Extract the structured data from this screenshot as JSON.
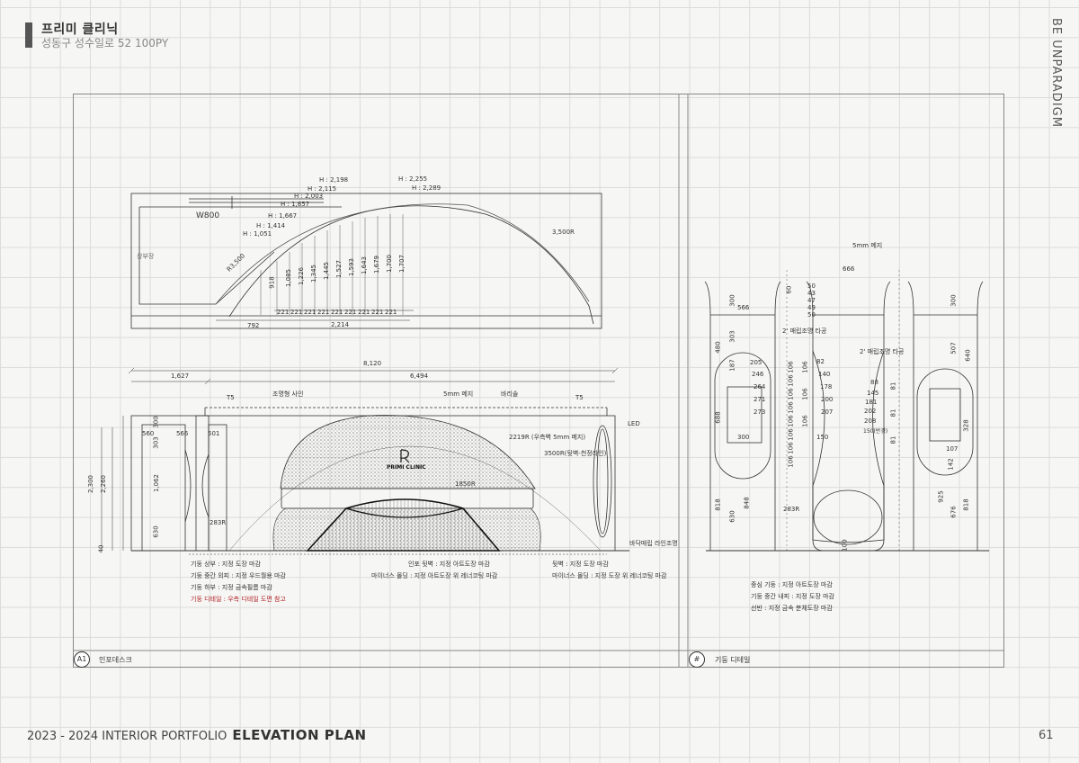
{
  "header": {
    "title": "프리미 클리닉",
    "subtitle": "성동구 성수일로 52 100PY"
  },
  "side_label": "BE UNPARADIGM",
  "footer": {
    "portfolio": "2023 - 2024 INTERIOR PORTFOLIO",
    "section": "ELEVATION PLAN",
    "page": "61"
  },
  "plan": {
    "heights": [
      "H : 2,198",
      "H : 2,115",
      "H : 2,003",
      "H : 1,857",
      "H : 1,667",
      "H : 1,414",
      "H : 1,051",
      "H : 2,255",
      "H : 2,289"
    ],
    "w800": "W800",
    "radius_small": "R3,500",
    "radius_large": "3,500R",
    "label_left": "상부장",
    "bar_dims": [
      "918",
      "1,085",
      "1,226",
      "1,345",
      "1,445",
      "1,527",
      "1,593",
      "1,643",
      "1,679",
      "1,700",
      "1,707"
    ],
    "step_dims": [
      "221",
      "221",
      "221",
      "221",
      "221",
      "221",
      "221",
      "221",
      "221"
    ],
    "bottom_left": "792",
    "bottom_total": "2,214"
  },
  "elevation": {
    "overall": "8,120",
    "left_dim": "1,627",
    "right_dim": "6,494",
    "t5_left": "T5",
    "t5_right": "T5",
    "sign": "조명형 사인",
    "mesh": "5mm 메지",
    "barrisol": "바리솔",
    "led": "LED",
    "r2219": "2219R (우측벽 5mm 메지)",
    "r3500": "3500R(뒷벽-천정라인)",
    "r1850": "1850R",
    "logo": "PRIMI CLINIC",
    "logo_mark": "P",
    "r283": "283R",
    "d560": "560",
    "d566": "566",
    "d501": "501",
    "d300": "300",
    "d303": "303",
    "d1062": "1,062",
    "d630": "630",
    "d2300": "2,300",
    "d2260": "2,260",
    "d40": "40",
    "floor_light": "바닥매립 라인조명"
  },
  "notes_left": [
    "기둥 상부 : 지정 도장 마감",
    "기둥 중간 외피 : 지정 우드월용 마감",
    "기둥 하부 : 지정 금속필름 마감",
    "기둥 디테일 : 우측 디테일 도면 참고"
  ],
  "notes_mid": [
    "인포 뒷벽 : 지정 아트도장 마감",
    "마이너스 몰딩 : 지정 아트도장 위 레너코팅 마감"
  ],
  "notes_right": [
    "뒷벽 : 지정 도장 마감",
    "마이너스 몰딩 : 지정 도장 위 레너코팅 마감"
  ],
  "column_detail": {
    "mesh": "5mm 메지",
    "d666": "666",
    "light_a": "2' 매립조명 타공",
    "light_b": "2' 매립조명 타공",
    "d300a": "300",
    "d566": "566",
    "d300b": "300",
    "d480": "480",
    "d303": "303",
    "d688": "688",
    "d818a": "818",
    "d630": "630",
    "d848": "848",
    "d300c": "300",
    "d187": "187",
    "d205": "205",
    "d246": "246",
    "d264": "264",
    "d271": "271",
    "d273": "273",
    "col_dims": [
      "106",
      "106",
      "106",
      "106",
      "106",
      "106",
      "106",
      "106",
      "106",
      "106",
      "106"
    ],
    "d60": "60",
    "small_stack": [
      "50",
      "43",
      "47",
      "49",
      "50"
    ],
    "d82": "82",
    "d140": "140",
    "d178": "178",
    "d200": "200",
    "d207": "207",
    "d150": "150",
    "d88": "88",
    "d145": "145",
    "d181": "181",
    "d202": "202",
    "d208": "208",
    "d150b": "150(반경)",
    "small81": "81",
    "d507": "507",
    "d640": "640",
    "d328": "328",
    "d107": "107",
    "d142": "142",
    "d925": "925",
    "d676": "676",
    "d818b": "818",
    "d100": "100",
    "r283": "283R"
  },
  "notes_column": [
    "중심 기둥 : 지정 아트도장 마감",
    "기둥 중간 내피 : 지정 도장 마감",
    "선반 : 지정 금속 분체도장 마감"
  ],
  "title_left": {
    "tag": "A1",
    "label": "인포데스크"
  },
  "title_right": {
    "tag": "#",
    "label": "기둥 디테일"
  }
}
